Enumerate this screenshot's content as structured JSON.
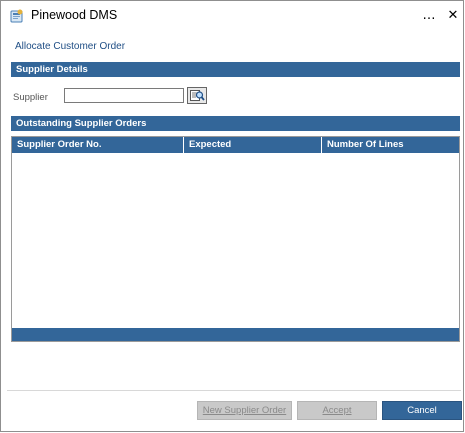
{
  "window": {
    "title": "Pinewood DMS",
    "minimize_glyph": "…",
    "close_glyph": "✕",
    "icon": "pinewood-app-icon"
  },
  "form": {
    "title": "Allocate Customer Order"
  },
  "supplier_section": {
    "header": "Supplier Details",
    "supplier_label": "Supplier",
    "supplier_value": "",
    "lookup_icon": "search-lookup-icon"
  },
  "orders_section": {
    "header": "Outstanding Supplier Orders",
    "columns": [
      "Supplier Order No.",
      "Expected",
      "Number Of Lines"
    ],
    "rows": []
  },
  "buttons": {
    "new_supplier_order": "New Supplier Order",
    "accept": "Accept",
    "cancel": "Cancel"
  },
  "colors": {
    "accent": "#336699",
    "title_text": "#1f4e85",
    "disabled_button": "#c9c9c9"
  }
}
